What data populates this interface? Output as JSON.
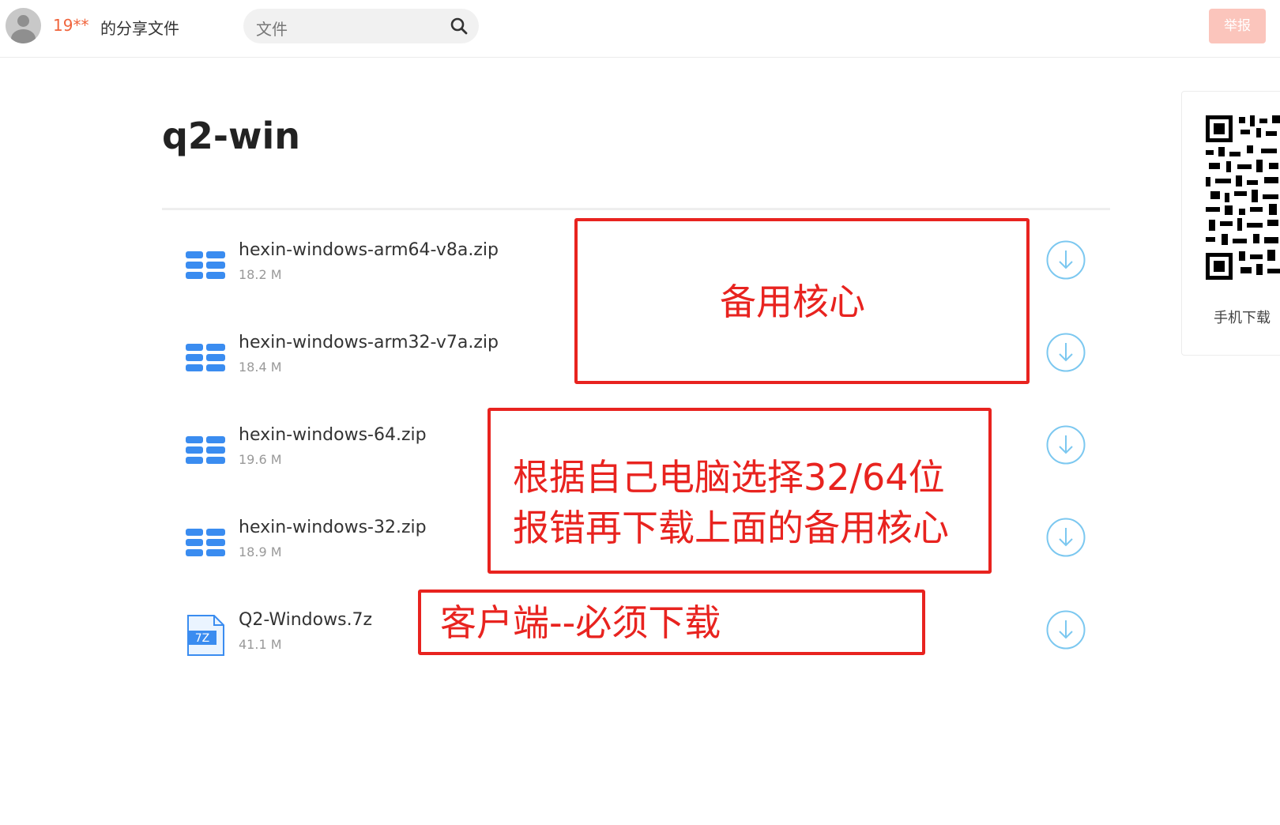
{
  "header": {
    "username": "19**",
    "share_label": "的分享文件",
    "search_placeholder": "文件",
    "report_label": "举报"
  },
  "sidebar_qr": {
    "label": "手机下载"
  },
  "page_title": "q2-win",
  "files": [
    {
      "name": "hexin-windows-arm64-v8a.zip",
      "size": "18.2 M",
      "type": "zip"
    },
    {
      "name": "hexin-windows-arm32-v7a.zip",
      "size": "18.4 M",
      "type": "zip"
    },
    {
      "name": "hexin-windows-64.zip",
      "size": "19.6 M",
      "type": "zip"
    },
    {
      "name": "hexin-windows-32.zip",
      "size": "18.9 M",
      "type": "zip"
    },
    {
      "name": "Q2-Windows.7z",
      "size": "41.1 M",
      "type": "7z",
      "badge": "7Z"
    }
  ],
  "annotations": {
    "backup_core": "备用核心",
    "choose_line1": "根据自己电脑选择32/64位",
    "choose_line2": "报错再下载上面的备用核心",
    "client": "客户端--必须下载"
  },
  "colors": {
    "accent_red": "#e8231f",
    "username": "#f0643c",
    "report_button": "#fbc5bc",
    "file_icon_blue": "#3a8cf0",
    "download_circle": "#7cc8f0"
  }
}
